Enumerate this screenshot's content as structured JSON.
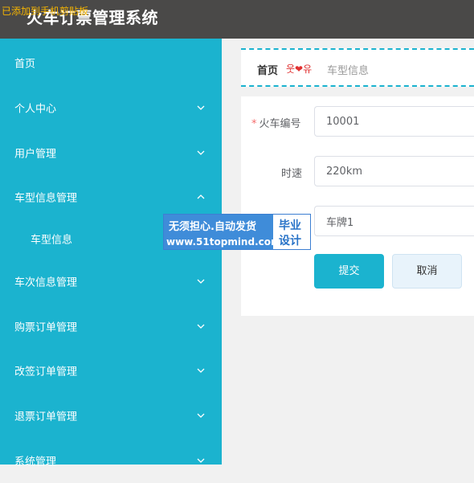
{
  "header": {
    "title": "火车订票管理系统",
    "notice": "已添加到手机剪贴板"
  },
  "sidebar": {
    "items": [
      {
        "label": "首页",
        "has_chevron": false
      },
      {
        "label": "个人中心",
        "has_chevron": true,
        "chevron": "down"
      },
      {
        "label": "用户管理",
        "has_chevron": true,
        "chevron": "down"
      },
      {
        "label": "车型信息管理",
        "has_chevron": true,
        "chevron": "up"
      },
      {
        "label": "车型信息",
        "has_chevron": false,
        "sub": true
      },
      {
        "label": "车次信息管理",
        "has_chevron": true,
        "chevron": "down"
      },
      {
        "label": "购票订单管理",
        "has_chevron": true,
        "chevron": "down"
      },
      {
        "label": "改签订单管理",
        "has_chevron": true,
        "chevron": "down"
      },
      {
        "label": "退票订单管理",
        "has_chevron": true,
        "chevron": "down"
      },
      {
        "label": "系统管理",
        "has_chevron": true,
        "chevron": "down"
      }
    ]
  },
  "breadcrumb": {
    "home": "首页",
    "separator": "웃❤유",
    "current": "车型信息"
  },
  "form": {
    "fields": [
      {
        "label": "火车编号",
        "value": "10001",
        "required": true
      },
      {
        "label": "时速",
        "value": "220km",
        "required": false
      },
      {
        "label": "",
        "value": "车牌1",
        "required": false
      }
    ],
    "required_mark": "*",
    "submit_label": "提交",
    "cancel_label": "取消"
  },
  "watermark": {
    "line1": "无须担心.自动发货",
    "line2": "www.51topmind.com",
    "badge_line1": "毕业",
    "badge_line2": "设计"
  },
  "colors": {
    "sidebar": "#1bb3cf",
    "header": "#4a4948",
    "accent": "#1bb3cf",
    "cancel_bg": "#e8f3fb"
  },
  "icons": {
    "chevron_down": "chevron-down-icon",
    "chevron_up": "chevron-up-icon"
  }
}
